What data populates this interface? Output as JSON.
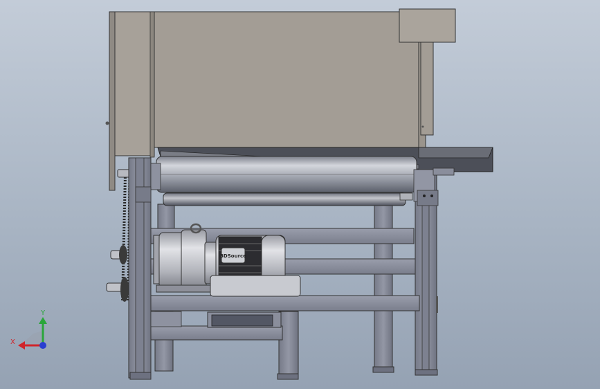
{
  "scene": {
    "background_top": "#c3ccd8",
    "background_bottom": "#95a2b3",
    "housing_color": "#a39d95",
    "frame_color": "#868a99",
    "roller_color": "#9ea2ad",
    "motor_color": "#bfc1c8"
  },
  "motor": {
    "brand_label": "3DSource"
  },
  "triad": {
    "x_label": "X",
    "y_label": "Y",
    "x_color": "#d0242a",
    "y_color": "#2aa63a",
    "z_color": "#2a3ed0"
  }
}
